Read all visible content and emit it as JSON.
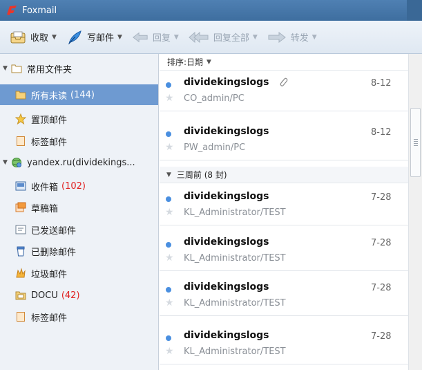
{
  "window": {
    "title": "Foxmail"
  },
  "toolbar": {
    "receive": {
      "label": "收取",
      "icon": "inbox-tray-icon"
    },
    "compose": {
      "label": "写邮件",
      "icon": "feather-pen-icon"
    },
    "reply": {
      "label": "回复",
      "icon": "reply-arrow-icon",
      "enabled": false
    },
    "reply_all": {
      "label": "回复全部",
      "icon": "reply-all-arrow-icon",
      "enabled": false
    },
    "forward": {
      "label": "转发",
      "icon": "forward-arrow-icon",
      "enabled": false
    }
  },
  "sidebar": {
    "common_folders": {
      "label": "常用文件夹"
    },
    "unread": {
      "label": "所有未读",
      "count": "(144)"
    },
    "pinned": {
      "label": "置顶邮件"
    },
    "flagged": {
      "label": "标签邮件"
    },
    "account": {
      "label": "yandex.ru(dividekings..."
    },
    "inbox": {
      "label": "收件箱",
      "count": "(102)"
    },
    "drafts": {
      "label": "草稿箱"
    },
    "sent": {
      "label": "已发送邮件"
    },
    "deleted": {
      "label": "已删除邮件"
    },
    "junk": {
      "label": "垃圾邮件"
    },
    "docu": {
      "label": "DOCU",
      "count": "(42)"
    },
    "account_flagged": {
      "label": "标签邮件"
    }
  },
  "list": {
    "sort_label": "排序:日期",
    "group_label": "三周前 (8 封)",
    "messages": [
      {
        "sender": "dividekingslogs",
        "subject": "CO_admin/PC",
        "date": "8-12",
        "attachment": true
      },
      {
        "sender": "dividekingslogs",
        "subject": "PW_admin/PC",
        "date": "8-12",
        "attachment": false
      },
      {
        "sender": "dividekingslogs",
        "subject": "KL_Administrator/TEST",
        "date": "7-28",
        "attachment": false
      },
      {
        "sender": "dividekingslogs",
        "subject": "KL_Administrator/TEST",
        "date": "7-28",
        "attachment": false
      },
      {
        "sender": "dividekingslogs",
        "subject": "KL_Administrator/TEST",
        "date": "7-28",
        "attachment": false
      },
      {
        "sender": "dividekingslogs",
        "subject": "KL_Administrator/TEST",
        "date": "7-28",
        "attachment": false
      }
    ]
  },
  "colors": {
    "accent": "#6e9ad1",
    "unread_dot": "#4a8fe0",
    "count_red": "#e02020"
  }
}
